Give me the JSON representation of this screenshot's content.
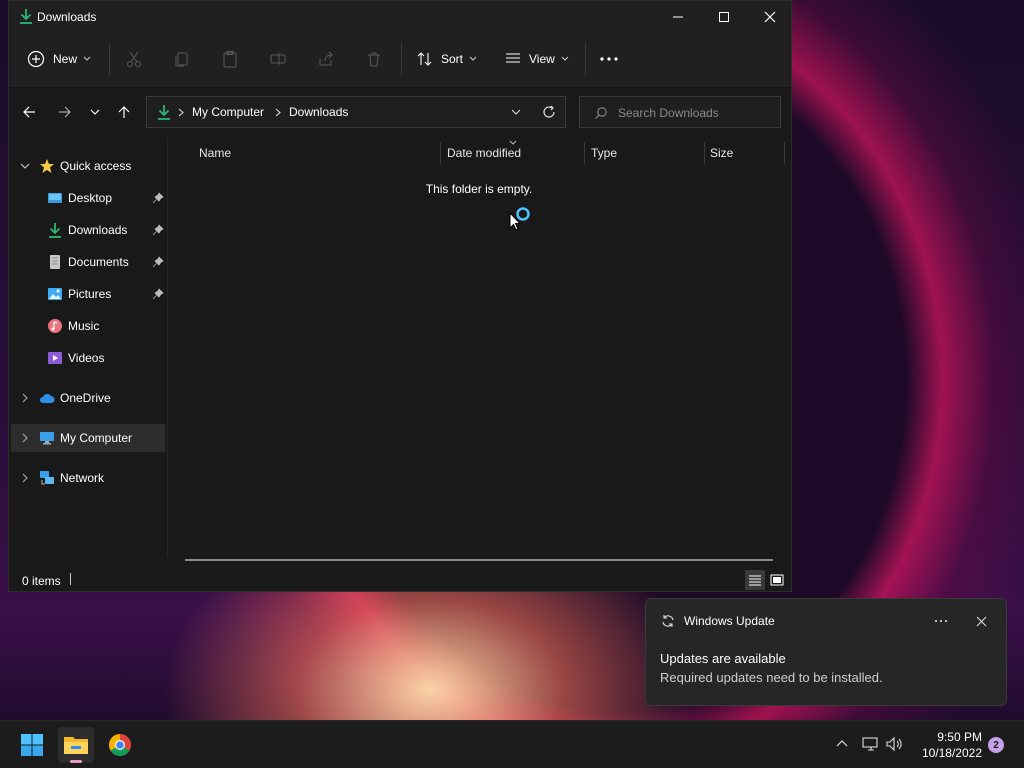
{
  "window": {
    "title": "Downloads",
    "controls": {
      "minimize": "minimize",
      "maximize": "maximize",
      "close": "close"
    }
  },
  "toolbar": {
    "new_label": "New",
    "sort_label": "Sort",
    "view_label": "View"
  },
  "address": {
    "crumbs": [
      "My Computer",
      "Downloads"
    ],
    "search_placeholder": "Search Downloads"
  },
  "sidebar": {
    "quick_access": "Quick access",
    "items": [
      {
        "label": "Desktop",
        "pinned": true
      },
      {
        "label": "Downloads",
        "pinned": true
      },
      {
        "label": "Documents",
        "pinned": true
      },
      {
        "label": "Pictures",
        "pinned": true
      },
      {
        "label": "Music",
        "pinned": false
      },
      {
        "label": "Videos",
        "pinned": false
      }
    ],
    "onedrive": "OneDrive",
    "my_computer": "My Computer",
    "network": "Network"
  },
  "columns": [
    "Name",
    "Date modified",
    "Type",
    "Size"
  ],
  "content": {
    "empty_message": "This folder is empty."
  },
  "status": {
    "item_count": "0 items"
  },
  "notification": {
    "app": "Windows Update",
    "title": "Updates are available",
    "body": "Required updates need to be installed."
  },
  "taskbar": {
    "time": "9:50 PM",
    "date": "10/18/2022",
    "notification_count": "2"
  },
  "colors": {
    "accent": "#4cc2ff",
    "download_green": "#2bb673",
    "badge": "#c4a1e8"
  }
}
